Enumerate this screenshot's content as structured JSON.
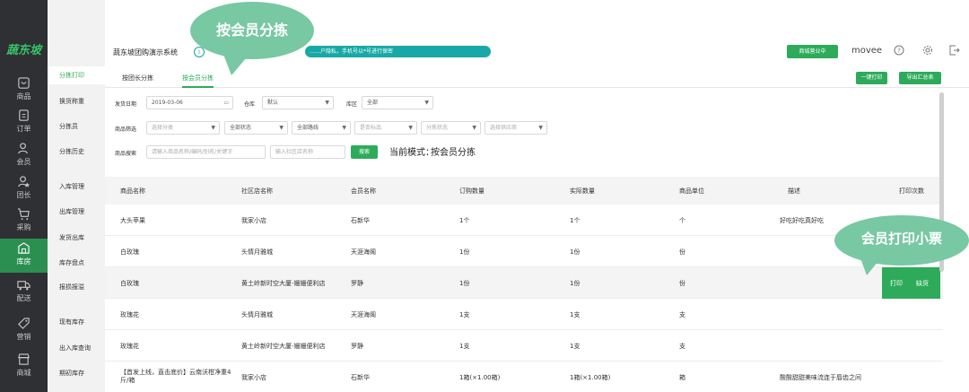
{
  "app": {
    "logo": "蔬东坡",
    "title": "蔬东坡团购演示系统",
    "notice_badge": "i",
    "notice_text": "……户隐私，手机号以*号进行保密",
    "store_button": "商城营业中",
    "username": "movee"
  },
  "rail": [
    {
      "label": "商品",
      "icon": "box-icon"
    },
    {
      "label": "订单",
      "icon": "clipboard-icon"
    },
    {
      "label": "会员",
      "icon": "users-icon"
    },
    {
      "label": "团长",
      "icon": "leader-icon"
    },
    {
      "label": "采购",
      "icon": "cart-icon"
    },
    {
      "label": "库房",
      "icon": "warehouse-icon"
    },
    {
      "label": "配送",
      "icon": "truck-icon"
    },
    {
      "label": "营销",
      "icon": "tag-icon"
    },
    {
      "label": "商城",
      "icon": "store-icon"
    }
  ],
  "subnav": [
    "分拣打印",
    "换货称重",
    "分拣员",
    "分拣历史",
    "入库管理",
    "出库管理",
    "发货出库",
    "库存盘点",
    "报损报溢",
    "现有库存",
    "出入库查询",
    "期初库存"
  ],
  "tabs": {
    "by_leader": "按团长分拣",
    "by_member": "按会员分拣"
  },
  "buttons": {
    "print_all": "一键打印",
    "export": "导出汇总表",
    "search": "搜索",
    "print": "打印",
    "short": "缺货"
  },
  "filters": {
    "ship_date_label": "发货日期",
    "ship_date_value": "2019-03-06",
    "warehouse_label": "仓库",
    "warehouse_value": "默认",
    "zone_label": "库区",
    "zone_value": "全部",
    "goods_filter_label": "商品筛选",
    "category_placeholder": "选择分类",
    "status_value": "全部状态",
    "route_value": "全部路线",
    "standard_placeholder": "是否标品",
    "sort_status_placeholder": "分拣状态",
    "supplier_placeholder": "选择供应商",
    "goods_search_label": "商品搜索",
    "goods_search_placeholder": "请输入商品名称/编码/别名/关键字",
    "store_search_placeholder": "输入社区店名称"
  },
  "mode": {
    "label": "当前模式：",
    "value": "按会员分拣"
  },
  "table": {
    "headers": [
      "商品名称",
      "社区店名称",
      "会员名称",
      "订购数量",
      "实际数量",
      "商品单位",
      "描述",
      "打印次数"
    ],
    "rows": [
      [
        "大头苹果",
        "我家小店",
        "石新华",
        "1个",
        "1个",
        "个",
        "好吃好吃真好吃"
      ],
      [
        "白玫瑰",
        "头情月雅城",
        "天涯海阁",
        "1份",
        "1份",
        "份",
        ""
      ],
      [
        "白玫瑰",
        "黄土岭新时空大厦-姗姗便利店",
        "罗静",
        "1份",
        "1份",
        "份",
        ""
      ],
      [
        "玫瑰花",
        "头情月雅城",
        "天涯海阁",
        "1支",
        "1支",
        "支",
        ""
      ],
      [
        "玫瑰花",
        "黄土岭新时空大厦-姗姗便利店",
        "罗静",
        "1支",
        "1支",
        "支",
        ""
      ],
      [
        "【首发上线，直击底价】云南沃柑净重4斤/箱",
        "我家小店",
        "石新华",
        "1箱(×1.00箱)",
        "1箱(×1.00箱)",
        "箱",
        "酸酸甜甜美味流连于唇齿之间"
      ]
    ]
  },
  "callouts": {
    "top": "按会员分拣",
    "right": "会员打印小票"
  },
  "colors": {
    "accent": "#2dab5a",
    "rail_bg": "#2f3033",
    "callout": "#78c8a3"
  }
}
